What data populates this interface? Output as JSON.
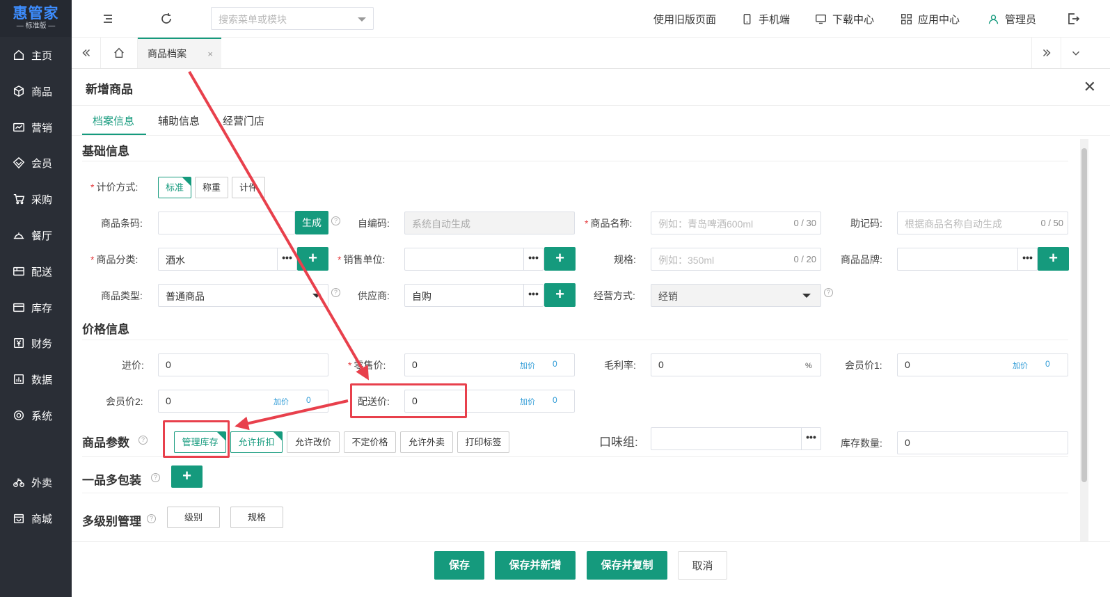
{
  "brand": {
    "name": "惠管家",
    "edition": "标准版"
  },
  "sidebar": {
    "items": [
      {
        "label": "主页",
        "icon": "home-icon"
      },
      {
        "label": "商品",
        "icon": "box-icon"
      },
      {
        "label": "营销",
        "icon": "chart-icon"
      },
      {
        "label": "会员",
        "icon": "diamond-icon"
      },
      {
        "label": "采购",
        "icon": "cart-icon"
      },
      {
        "label": "餐厅",
        "icon": "dish-icon"
      },
      {
        "label": "配送",
        "icon": "truck-icon"
      },
      {
        "label": "库存",
        "icon": "folder-icon"
      },
      {
        "label": "财务",
        "icon": "yen-icon"
      },
      {
        "label": "数据",
        "icon": "data-icon"
      },
      {
        "label": "系统",
        "icon": "settings-icon"
      },
      {
        "label": "外卖",
        "icon": "bike-icon"
      },
      {
        "label": "商城",
        "icon": "store-icon"
      }
    ]
  },
  "topbar": {
    "search_placeholder": "搜索菜单或模块",
    "old_page": "使用旧版页面",
    "mobile": "手机端",
    "download": "下载中心",
    "apps": "应用中心",
    "user": "管理员"
  },
  "tabs": {
    "active": "商品档案",
    "close": "×"
  },
  "panel": {
    "title": "新增商品",
    "close": "✕"
  },
  "subtabs": [
    "档案信息",
    "辅助信息",
    "经营门店"
  ],
  "basic": {
    "section": "基础信息",
    "pricing_label": "计价方式:",
    "pricing_options": [
      "标准",
      "称重",
      "计件"
    ],
    "barcode_label": "商品条码:",
    "generate": "生成",
    "selfcode_label": "自编码:",
    "selfcode_value": "系统自动生成",
    "name_label": "商品名称:",
    "name_placeholder": "例如：青岛啤酒600ml",
    "name_count": "0 / 30",
    "mnemonic_label": "助记码:",
    "mnemonic_placeholder": "根据商品名称自动生成",
    "mnemonic_count": "0 / 50",
    "category_label": "商品分类:",
    "category_value": "酒水",
    "unit_label": "销售单位:",
    "spec_label": "规格:",
    "spec_placeholder": "例如：350ml",
    "spec_count": "0 / 20",
    "brand_label": "商品品牌:",
    "type_label": "商品类型:",
    "type_value": "普通商品",
    "supplier_label": "供应商:",
    "supplier_value": "自购",
    "mode_label": "经营方式:",
    "mode_value": "经销",
    "dots": "•••",
    "plus": "+"
  },
  "price": {
    "section": "价格信息",
    "purchase_label": "进价:",
    "purchase_value": "0",
    "retail_label": "零售价:",
    "retail_value": "0",
    "margin_label": "毛利率:",
    "margin_value": "0",
    "percent": "%",
    "member1_label": "会员价1:",
    "member1_value": "0",
    "member2_label": "会员价2:",
    "member2_value": "0",
    "delivery_label": "配送价:",
    "delivery_value": "0",
    "add_price": "加价",
    "add_value": "0"
  },
  "params": {
    "section": "商品参数",
    "options": [
      {
        "label": "管理库存",
        "selected": true
      },
      {
        "label": "允许折扣",
        "selected": true
      },
      {
        "label": "允许改价",
        "selected": false
      },
      {
        "label": "不定价格",
        "selected": false
      },
      {
        "label": "允许外卖",
        "selected": false
      },
      {
        "label": "打印标签",
        "selected": false
      }
    ],
    "taste_label": "口味组:",
    "stock_label": "库存数量:",
    "stock_value": "0"
  },
  "multipack": {
    "section": "一品多包装"
  },
  "multilevel": {
    "section": "多级别管理",
    "level": "级别",
    "spec": "规格"
  },
  "footer": {
    "save": "保存",
    "save_new": "保存并新增",
    "save_copy": "保存并复制",
    "cancel": "取消"
  },
  "colors": {
    "accent": "#159a7d",
    "sidebar_bg": "#2a2e36",
    "annotation": "#e8404c",
    "required": "#e4393c",
    "link": "#2e9bd6"
  }
}
